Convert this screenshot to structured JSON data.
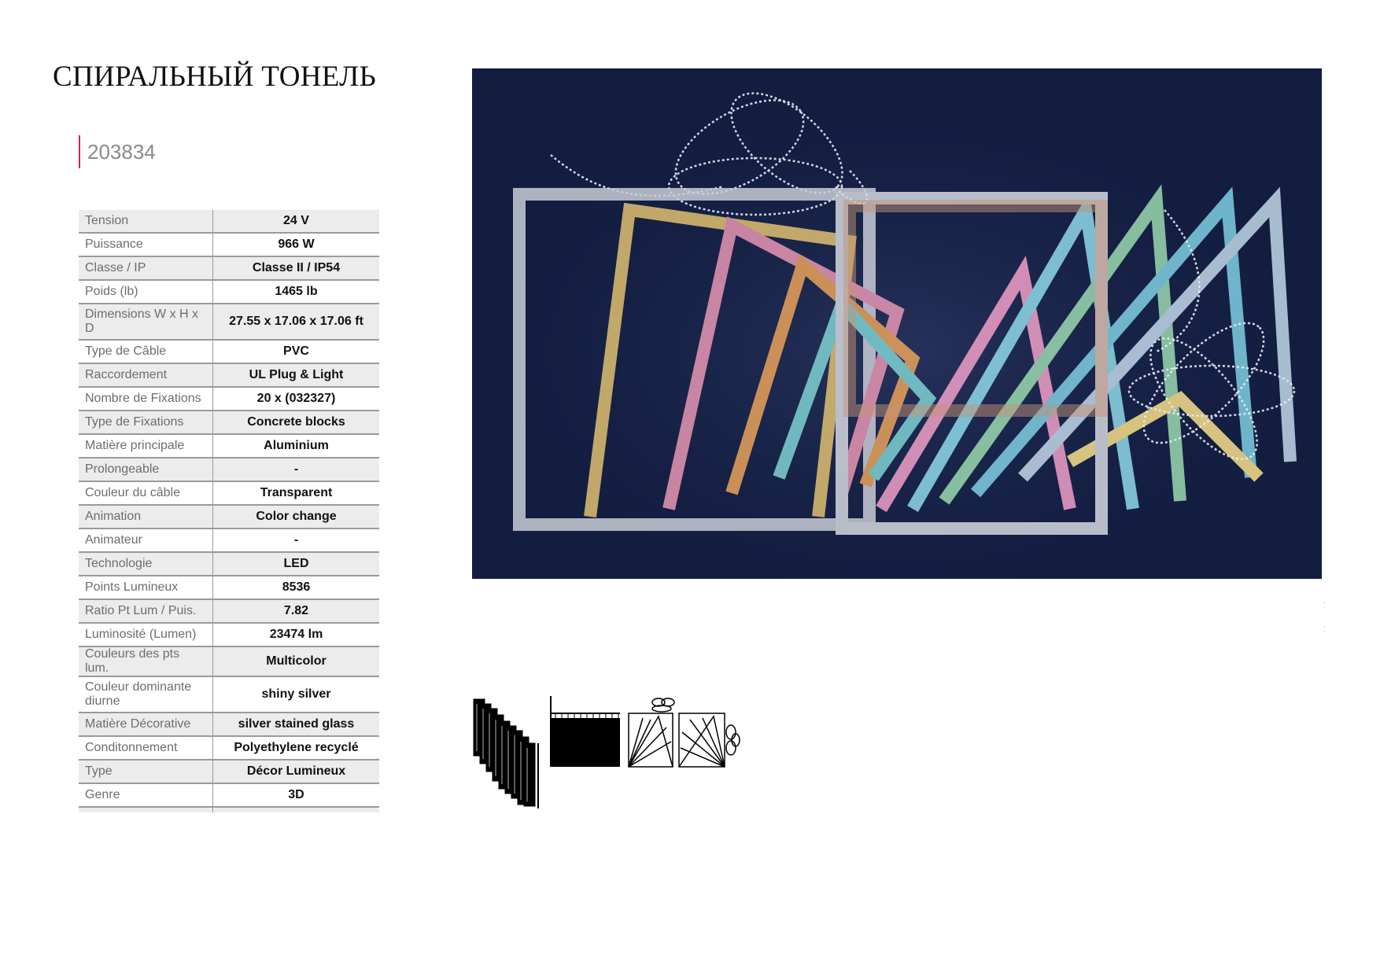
{
  "document": {
    "title": "СПИРАЛЬНЫЙ ТОНЕЛЬ",
    "reference": "203834"
  },
  "specs": [
    {
      "label": "Tension",
      "value": "24 V"
    },
    {
      "label": "Puissance",
      "value": "966 W"
    },
    {
      "label": "Classe / IP",
      "value": "Classe II / IP54"
    },
    {
      "label": "Poids (lb)",
      "value": "1465 lb"
    },
    {
      "label": "Dimensions W x H x D",
      "value": "27.55 x 17.06 x 17.06 ft"
    },
    {
      "label": "Type de Câble",
      "value": "PVC"
    },
    {
      "label": "Raccordement",
      "value": "UL Plug & Light"
    },
    {
      "label": "Nombre de Fixations",
      "value": "20 x (032327)"
    },
    {
      "label": "Type de Fixations",
      "value": "Concrete blocks"
    },
    {
      "label": "Matière principale",
      "value": "Aluminium"
    },
    {
      "label": "Prolongeable",
      "value": "-"
    },
    {
      "label": "Couleur du câble",
      "value": "Transparent"
    },
    {
      "label": "Animation",
      "value": "Color change"
    },
    {
      "label": "Animateur",
      "value": "-"
    },
    {
      "label": "Technologie",
      "value": "LED"
    },
    {
      "label": "Points Lumineux",
      "value": "8536"
    },
    {
      "label": "Ratio Pt Lum / Puis.",
      "value": "7.82"
    },
    {
      "label": "Luminosité (Lumen)",
      "value": "23474 lm"
    },
    {
      "label": "Couleurs des pts lum.",
      "value": "Multicolor"
    },
    {
      "label": "Couleur dominante diurne",
      "value": "shiny silver"
    },
    {
      "label": "Matière Décorative",
      "value": "silver stained glass"
    },
    {
      "label": "Conditonnement",
      "value": "Polyethylene recyclé"
    },
    {
      "label": "Type",
      "value": "Décor Lumineux"
    },
    {
      "label": "Genre",
      "value": "3D"
    }
  ],
  "colors": {
    "accent": "#c8294f",
    "photo_background": "#121d40",
    "table_stripe": "#ececec"
  },
  "images": {
    "product_photo": "illuminated-spiral-gift-tunnel-photo",
    "schematics": [
      "side-view-schematic",
      "front-view-schematic",
      "perspective-view-schematic"
    ]
  }
}
